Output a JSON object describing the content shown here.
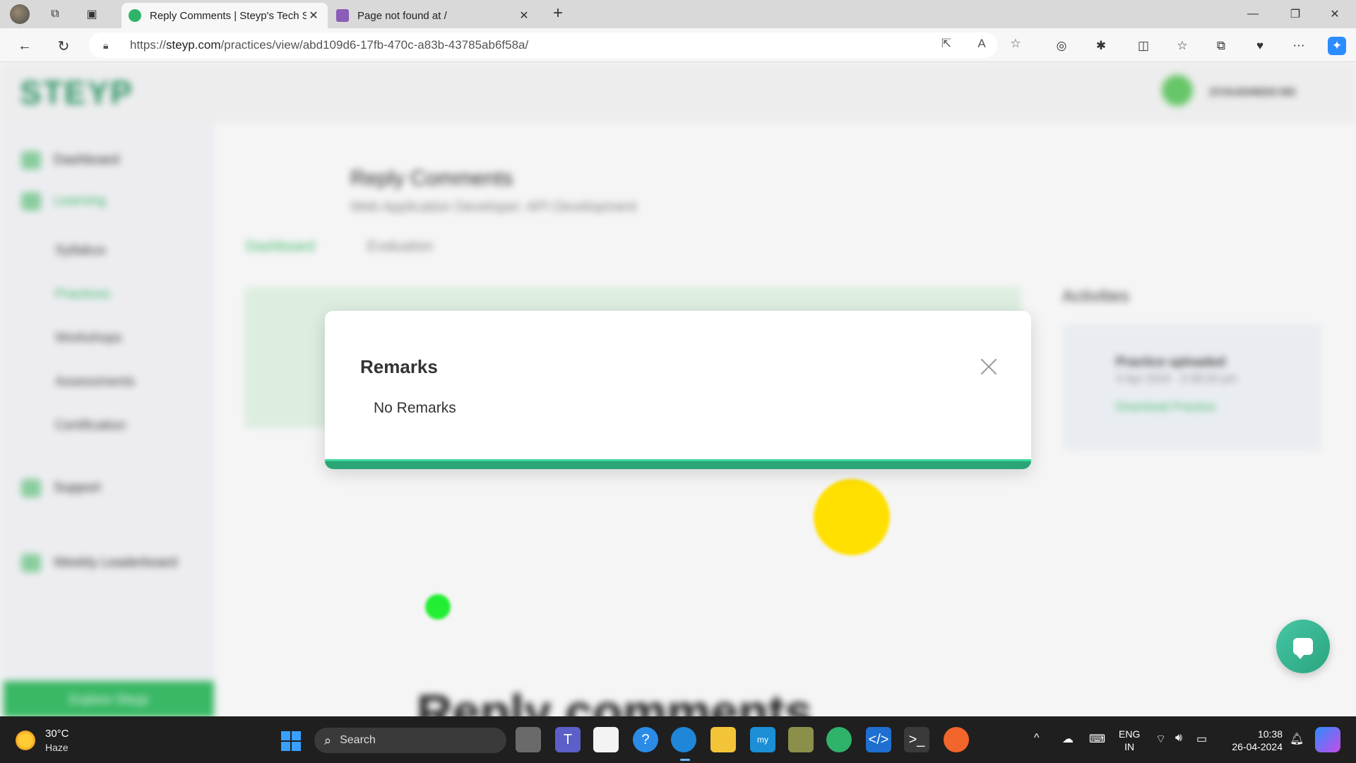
{
  "browser": {
    "tabs": [
      {
        "title": "Reply Comments | Steyp's Tech S",
        "active": true
      },
      {
        "title": "Page not found at /",
        "active": false
      }
    ],
    "url_prefix": "https://",
    "url_domain": "steyp.com",
    "url_path": "/practices/view/abd109d6-17fb-470c-a83b-43785ab6f58a/"
  },
  "page": {
    "logo": "STEYP",
    "user_name": "ZIYAUDHEEN MS",
    "sidebar": {
      "items": [
        "Dashboard",
        "Learning"
      ],
      "sub_items": [
        "Syllabus",
        "Practices",
        "Workshops",
        "Assessments",
        "Certification"
      ],
      "support": "Support",
      "leaderboard": "Weekly Leaderboard",
      "explore": "Explore Steyp"
    },
    "title": "Reply Comments",
    "subtitle": "Web Application Developer: API Development",
    "tabs": [
      "Dashboard",
      "Evaluation"
    ],
    "activities_title": "Activities",
    "activity": {
      "title": "Practice uploaded",
      "time": "4 Apr 2024 · 3:38:20 pm",
      "link": "Download Practice"
    },
    "footer_heading": "Reply comments"
  },
  "modal": {
    "title": "Remarks",
    "body": "No Remarks"
  },
  "taskbar": {
    "weather_temp": "30°C",
    "weather_desc": "Haze",
    "search_placeholder": "Search",
    "lang_line1": "ENG",
    "lang_line2": "IN",
    "time": "10:38",
    "date": "26-04-2024"
  },
  "colors": {
    "accent": "#2aa575",
    "accent_light": "#3ad79a",
    "brand_green": "#3cc06a",
    "taskbar_bg": "#1f1f1f"
  }
}
